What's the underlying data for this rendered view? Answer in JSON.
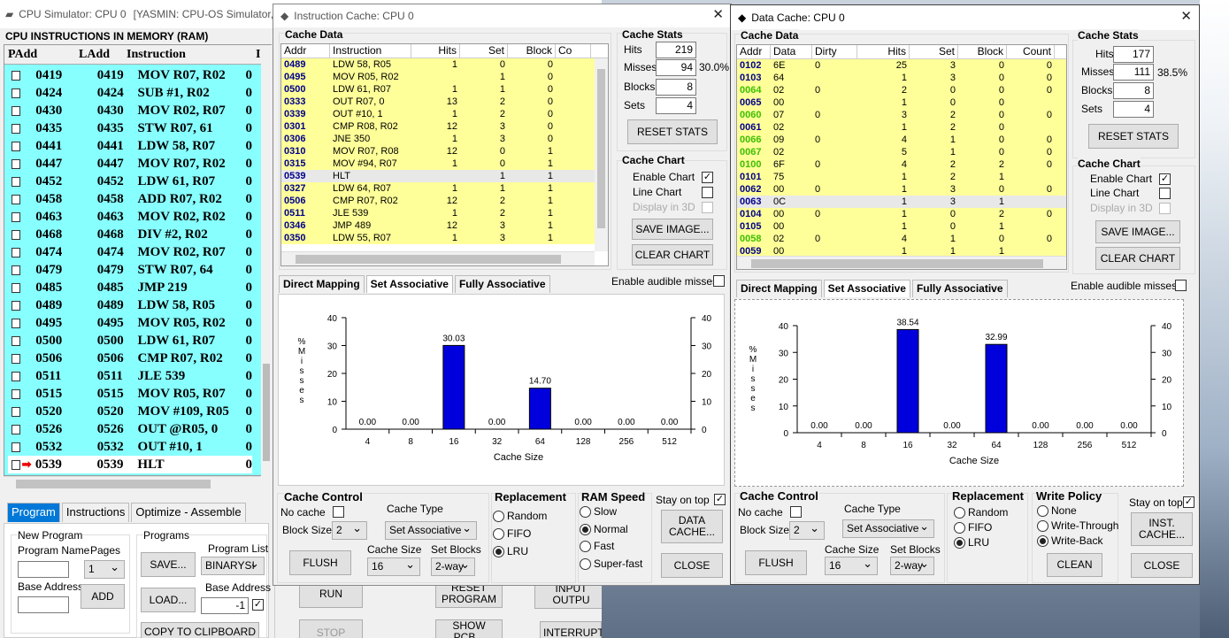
{
  "main": {
    "title": "CPU Simulator: CPU 0",
    "title_extra": "[YASMIN: CPU-OS Simulator,",
    "ram_header": "CPU INSTRUCTIONS IN MEMORY (RAM)",
    "cols": [
      "PAdd",
      "LAdd",
      "Instruction",
      "I"
    ],
    "rows": [
      [
        "0419",
        "0419",
        "MOV R07, R02"
      ],
      [
        "0424",
        "0424",
        "SUB #1, R02"
      ],
      [
        "0430",
        "0430",
        "MOV R02, R07"
      ],
      [
        "0435",
        "0435",
        "STW R07, 61"
      ],
      [
        "0441",
        "0441",
        "LDW 58, R07"
      ],
      [
        "0447",
        "0447",
        "MOV R07, R02"
      ],
      [
        "0452",
        "0452",
        "LDW 61, R07"
      ],
      [
        "0458",
        "0458",
        "ADD R07, R02"
      ],
      [
        "0463",
        "0463",
        "MOV R02, R02"
      ],
      [
        "0468",
        "0468",
        "DIV #2, R02"
      ],
      [
        "0474",
        "0474",
        "MOV R02, R07"
      ],
      [
        "0479",
        "0479",
        "STW R07, 64"
      ],
      [
        "0485",
        "0485",
        "JMP 219"
      ],
      [
        "0489",
        "0489",
        "LDW 58, R05"
      ],
      [
        "0495",
        "0495",
        "MOV R05, R02"
      ],
      [
        "0500",
        "0500",
        "LDW 61, R07"
      ],
      [
        "0506",
        "0506",
        "CMP R07, R02"
      ],
      [
        "0511",
        "0511",
        "JLE 539"
      ],
      [
        "0515",
        "0515",
        "MOV R05, R07"
      ],
      [
        "0520",
        "0520",
        "MOV #109, R05"
      ],
      [
        "0526",
        "0526",
        "OUT @R05, 0"
      ],
      [
        "0532",
        "0532",
        "OUT #10, 1"
      ],
      [
        "0539",
        "0539",
        "HLT"
      ]
    ],
    "row_tail": "0",
    "tabs": [
      "Program",
      "Instructions",
      "Optimize - Assemble"
    ],
    "new_program": "New Program",
    "program_name": "Program Name",
    "pages": "Pages",
    "pages_val": "1",
    "base_address": "Base Address",
    "add": "ADD",
    "programs": "Programs",
    "program_list": "Program List",
    "program_list_val": "BINARYSI",
    "save": "SAVE...",
    "load": "LOAD...",
    "base_address2": "Base Address",
    "base_val": "-1",
    "copy": "COPY TO CLIPBOARD",
    "run": "RUN",
    "stop": "STOP",
    "reset": "RESET PROGRAM",
    "showpcb": "SHOW PCB...",
    "inout": "INPUT OUTPU",
    "interrupt": "INTERRUPT"
  },
  "icache": {
    "title": "Instruction Cache: CPU 0",
    "cache_data": "Cache Data",
    "cols": [
      "Addr",
      "Instruction",
      "Hits",
      "Set",
      "Block",
      "Co"
    ],
    "rows": [
      [
        "0489",
        "LDW 58, R05",
        "1",
        "0",
        "0"
      ],
      [
        "0495",
        "MOV R05, R02",
        "",
        "1",
        "0"
      ],
      [
        "0500",
        "LDW 61, R07",
        "1",
        "1",
        "0"
      ],
      [
        "0333",
        "OUT R07, 0",
        "13",
        "2",
        "0"
      ],
      [
        "0339",
        "OUT #10, 1",
        "1",
        "2",
        "0"
      ],
      [
        "0301",
        "CMP R08, R02",
        "12",
        "3",
        "0"
      ],
      [
        "0306",
        "JNE 350",
        "1",
        "3",
        "0"
      ],
      [
        "0310",
        "MOV R07, R08",
        "12",
        "0",
        "1"
      ],
      [
        "0315",
        "MOV #94, R07",
        "1",
        "0",
        "1"
      ],
      [
        "0539",
        "HLT",
        "",
        "1",
        "1"
      ],
      [
        "0327",
        "LDW 64, R07",
        "1",
        "1",
        "1"
      ],
      [
        "0506",
        "CMP R07, R02",
        "12",
        "2",
        "1"
      ],
      [
        "0511",
        "JLE 539",
        "1",
        "2",
        "1"
      ],
      [
        "0346",
        "JMP 489",
        "12",
        "3",
        "1"
      ],
      [
        "0350",
        "LDW 55, R07",
        "1",
        "3",
        "1"
      ]
    ],
    "stats": {
      "title": "Cache Stats",
      "hits_l": "Hits",
      "hits": "219",
      "misses_l": "Misses",
      "misses": "94",
      "pct": "30.0%",
      "blocks_l": "Blocks",
      "blocks": "8",
      "sets_l": "Sets",
      "sets": "4",
      "reset": "RESET STATS"
    },
    "chart": {
      "title": "Cache Chart",
      "enable": "Enable Chart",
      "line": "Line Chart",
      "d3": "Display in 3D",
      "save": "SAVE IMAGE...",
      "clear": "CLEAR CHART"
    },
    "tabs": [
      "Direct Mapping",
      "Set Associative",
      "Fully Associative"
    ],
    "audible": "Enable audible misses",
    "control": {
      "title": "Cache Control",
      "nocache": "No cache",
      "blocksize": "Block Size",
      "blocksize_v": "2",
      "type": "Cache Type",
      "type_v": "Set Associative",
      "flush": "FLUSH",
      "size": "Cache Size",
      "size_v": "16",
      "setblocks": "Set Blocks",
      "setblocks_v": "2-way"
    },
    "replacement": {
      "title": "Replacement",
      "opts": [
        "Random",
        "FIFO",
        "LRU"
      ]
    },
    "ram": {
      "title": "RAM Speed",
      "opts": [
        "Slow",
        "Normal",
        "Fast",
        "Super-fast"
      ]
    },
    "stay": "Stay on top",
    "other": "DATA CACHE...",
    "close": "CLOSE"
  },
  "dcache": {
    "title": "Data Cache: CPU 0",
    "cache_data": "Cache Data",
    "cols": [
      "Addr",
      "Data",
      "Dirty",
      "Hits",
      "Set",
      "Block",
      "Count"
    ],
    "rows": [
      [
        "0102",
        "6E",
        "0",
        "25",
        "3",
        "0",
        "0",
        0
      ],
      [
        "0103",
        "64",
        "",
        "1",
        "3",
        "0",
        "0",
        0
      ],
      [
        "0064",
        "02",
        "0",
        "2",
        "0",
        "0",
        "0",
        1
      ],
      [
        "0065",
        "00",
        "",
        "1",
        "0",
        "0",
        "",
        0
      ],
      [
        "0060",
        "07",
        "0",
        "3",
        "2",
        "0",
        "0",
        1
      ],
      [
        "0061",
        "02",
        "",
        "1",
        "2",
        "0",
        "",
        0
      ],
      [
        "0066",
        "09",
        "0",
        "4",
        "1",
        "0",
        "0",
        1
      ],
      [
        "0067",
        "02",
        "",
        "5",
        "1",
        "0",
        "0",
        1
      ],
      [
        "0100",
        "6F",
        "0",
        "4",
        "2",
        "2",
        "0",
        1
      ],
      [
        "0101",
        "75",
        "",
        "1",
        "2",
        "1",
        "",
        0
      ],
      [
        "0062",
        "00",
        "0",
        "1",
        "3",
        "0",
        "0",
        0
      ],
      [
        "0063",
        "0C",
        "",
        "1",
        "3",
        "1",
        "",
        0
      ],
      [
        "0104",
        "00",
        "0",
        "1",
        "0",
        "2",
        "0",
        0
      ],
      [
        "0105",
        "00",
        "",
        "1",
        "0",
        "1",
        "",
        0
      ],
      [
        "0058",
        "02",
        "0",
        "4",
        "1",
        "0",
        "0",
        1
      ],
      [
        "0059",
        "00",
        "",
        "1",
        "1",
        "1",
        "",
        0
      ]
    ],
    "stats": {
      "title": "Cache Stats",
      "hits_l": "Hits",
      "hits": "177",
      "misses_l": "Misses",
      "misses": "111",
      "pct": "38.5%",
      "blocks_l": "Blocks",
      "blocks": "8",
      "sets_l": "Sets",
      "sets": "4",
      "reset": "RESET STATS"
    },
    "chart": {
      "title": "Cache Chart",
      "enable": "Enable Chart",
      "line": "Line Chart",
      "d3": "Display in 3D",
      "save": "SAVE IMAGE...",
      "clear": "CLEAR CHART"
    },
    "tabs": [
      "Direct Mapping",
      "Set Associative",
      "Fully Associative"
    ],
    "audible": "Enable audible misses",
    "control": {
      "title": "Cache Control",
      "nocache": "No cache",
      "blocksize": "Block Size",
      "blocksize_v": "2",
      "type": "Cache Type",
      "type_v": "Set Associative",
      "flush": "FLUSH",
      "size": "Cache Size",
      "size_v": "16",
      "setblocks": "Set Blocks",
      "setblocks_v": "2-way"
    },
    "replacement": {
      "title": "Replacement",
      "opts": [
        "Random",
        "FIFO",
        "LRU"
      ]
    },
    "policy": {
      "title": "Write Policy",
      "opts": [
        "None",
        "Write-Through",
        "Write-Back"
      ],
      "clean": "CLEAN"
    },
    "stay": "Stay on top",
    "other": "INST. CACHE...",
    "close": "CLOSE"
  },
  "chart_data": [
    {
      "type": "bar",
      "categories": [
        "4",
        "8",
        "16",
        "32",
        "64",
        "128",
        "256",
        "512"
      ],
      "values": [
        0,
        0,
        30.03,
        0,
        14.7,
        0,
        0,
        0
      ],
      "labels": [
        "0.00",
        "0.00",
        "30.03",
        "0.00",
        "14.70",
        "0.00",
        "0.00",
        "0.00"
      ],
      "xlabel": "Cache Size",
      "ylabel": "% Misses",
      "ylim": [
        0,
        40
      ],
      "yticks": [
        "0",
        "10",
        "20",
        "30",
        "40"
      ],
      "color": "#0000dd"
    },
    {
      "type": "bar",
      "categories": [
        "4",
        "8",
        "16",
        "32",
        "64",
        "128",
        "256",
        "512"
      ],
      "values": [
        0,
        0,
        38.54,
        0,
        32.99,
        0,
        0,
        0
      ],
      "labels": [
        "0.00",
        "0.00",
        "38.54",
        "0.00",
        "32.99",
        "0.00",
        "0.00",
        "0.00"
      ],
      "xlabel": "Cache Size",
      "ylabel": "% Misses",
      "ylim": [
        0,
        40
      ],
      "yticks": [
        "0",
        "10",
        "20",
        "30",
        "40"
      ],
      "color": "#0000dd"
    }
  ]
}
